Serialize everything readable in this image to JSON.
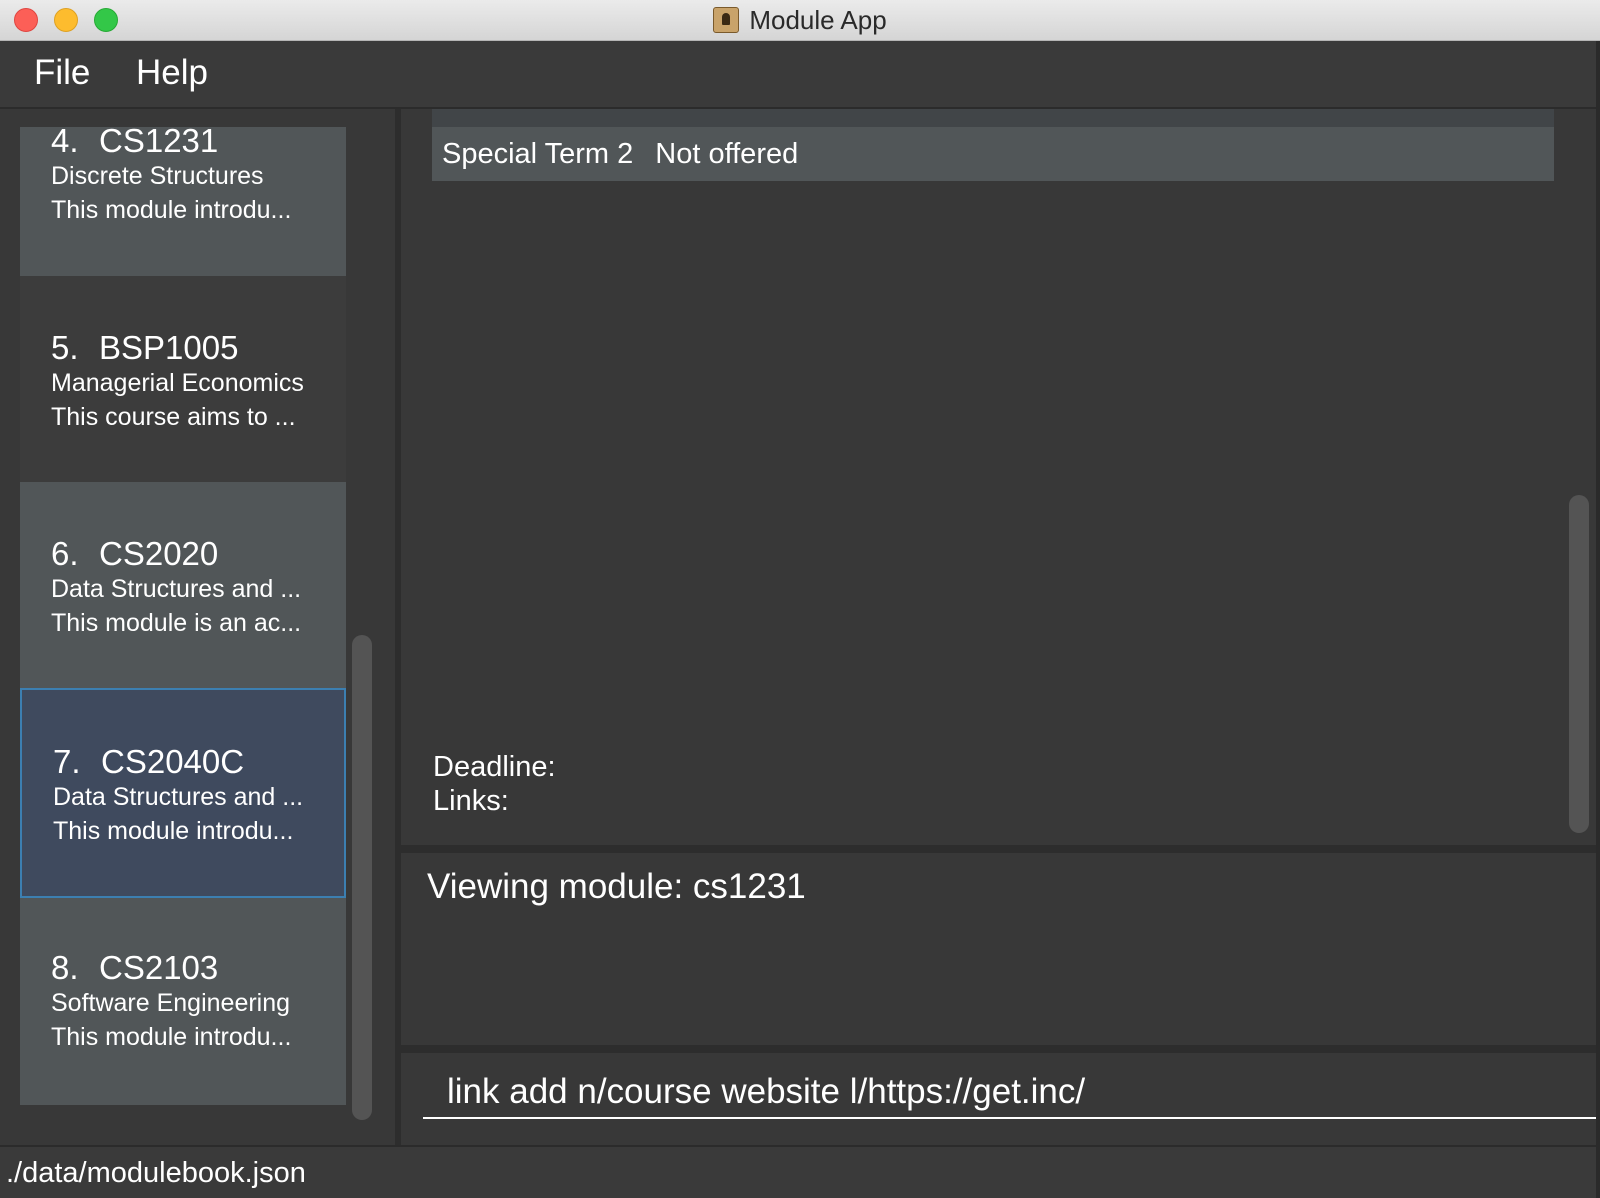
{
  "window": {
    "title": "Module App"
  },
  "menu": {
    "items": [
      "File",
      "Help"
    ]
  },
  "modules": [
    {
      "index": "4.",
      "code": "CS1231",
      "name": "Discrete Structures",
      "description": "This module introdu..."
    },
    {
      "index": "5.",
      "code": "BSP1005",
      "name": "Managerial Economics",
      "description": "This course aims to ..."
    },
    {
      "index": "6.",
      "code": "CS2020",
      "name": "Data Structures and ...",
      "description": "This module is an ac..."
    },
    {
      "index": "7.",
      "code": "CS2040C",
      "name": "Data Structures and ...",
      "description": "This module introdu..."
    },
    {
      "index": "8.",
      "code": "CS2103",
      "name": "Software Engineering",
      "description": "This module introdu..."
    }
  ],
  "detail": {
    "terms": [
      {
        "term": "Special Term 2",
        "status": "Not offered"
      }
    ],
    "deadline_label": "Deadline:",
    "links_label": "Links:"
  },
  "result": {
    "message": "Viewing module: cs1231"
  },
  "command": {
    "value": "link add n/course website l/https://get.inc/"
  },
  "status": {
    "file_path": "./data/modulebook.json"
  }
}
